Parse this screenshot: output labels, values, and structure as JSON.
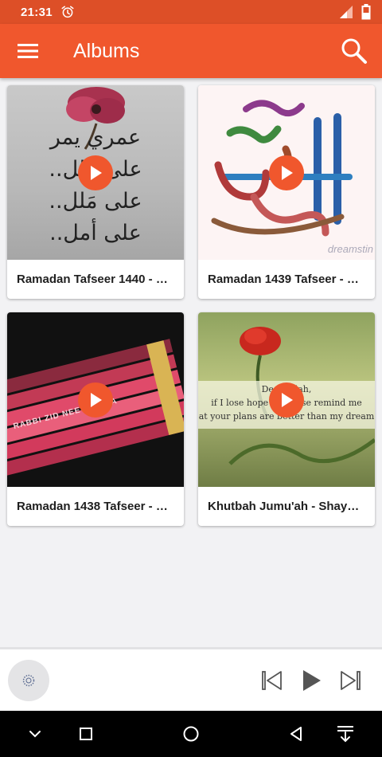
{
  "status": {
    "time": "21:31"
  },
  "app_bar": {
    "title": "Albums"
  },
  "albums": [
    {
      "title": "Ramadan Tafseer 1440 - Sh…",
      "thumb_lines": [
        "عمري يمر",
        "على مَلل..",
        "على مَلل..",
        "على أمل.."
      ]
    },
    {
      "title": "Ramadan 1439 Tafseer - Sh…",
      "watermark": "dreamstin"
    },
    {
      "title": "Ramadan 1438 Tafseer - Sh…",
      "pencil_text": "RABBI ZID NEE 'IL MAA"
    },
    {
      "title": "Khutbah Jumu'ah - Shaykh …",
      "note_lines": [
        "Dear Allah,",
        "if I lose hope to please remind me",
        "at your plans are better than my dream"
      ]
    }
  ],
  "colors": {
    "accent": "#f0572d",
    "status_bar": "#dd4f27"
  },
  "icons": {
    "menu": "hamburger-icon",
    "search": "search-icon",
    "play": "play-icon",
    "prev": "skip-previous-icon",
    "next": "skip-next-icon"
  }
}
